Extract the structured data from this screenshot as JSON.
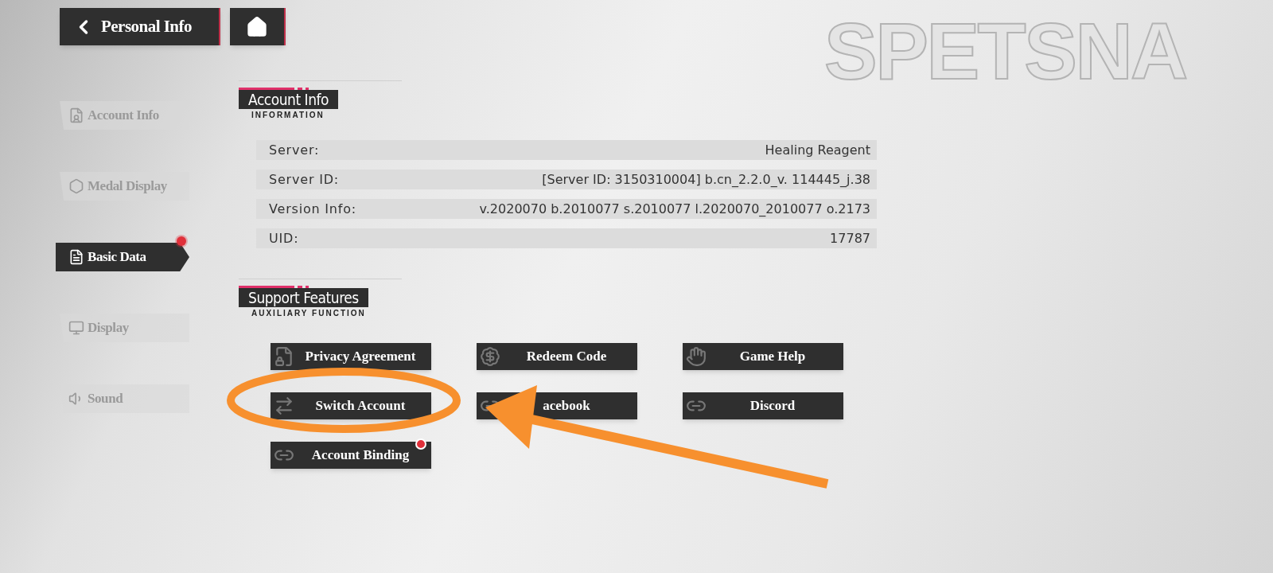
{
  "top_bar": {
    "back_button": {
      "label": "Personal Info"
    }
  },
  "background_text": "SPETSNA",
  "sidebar": {
    "items": [
      {
        "label": "Account Info",
        "selected": false,
        "badge": false
      },
      {
        "label": "Medal Display",
        "selected": false,
        "badge": false
      },
      {
        "label": "Basic Data",
        "selected": true,
        "badge": true
      },
      {
        "label": "Display",
        "selected": false,
        "badge": false
      },
      {
        "label": "Sound",
        "selected": false,
        "badge": false
      }
    ]
  },
  "account_info": {
    "title": "Account Info",
    "subtitle": "INFORMATION",
    "rows": [
      {
        "label": "Server:",
        "value": "Healing Reagent"
      },
      {
        "label": "Server ID:",
        "value": "[Server ID: 3150310004] b.cn_2.2.0_v. 114445_j.38"
      },
      {
        "label": "Version Info:",
        "value": "v.2020070 b.2010077 s.2010077 l.2020070_2010077 o.2173"
      },
      {
        "label": "UID:",
        "value": "17787"
      }
    ]
  },
  "support_features": {
    "title": "Support Features",
    "subtitle": "AUXILIARY FUNCTION",
    "buttons": [
      {
        "label": "Privacy Agreement",
        "badge": false
      },
      {
        "label": "Redeem Code",
        "badge": false
      },
      {
        "label": "Game Help",
        "badge": false
      },
      {
        "label": "Switch Account",
        "badge": false
      },
      {
        "label": "acebook",
        "badge": false
      },
      {
        "label": "Discord",
        "badge": false
      },
      {
        "label": "Account Binding",
        "badge": true
      }
    ]
  }
}
